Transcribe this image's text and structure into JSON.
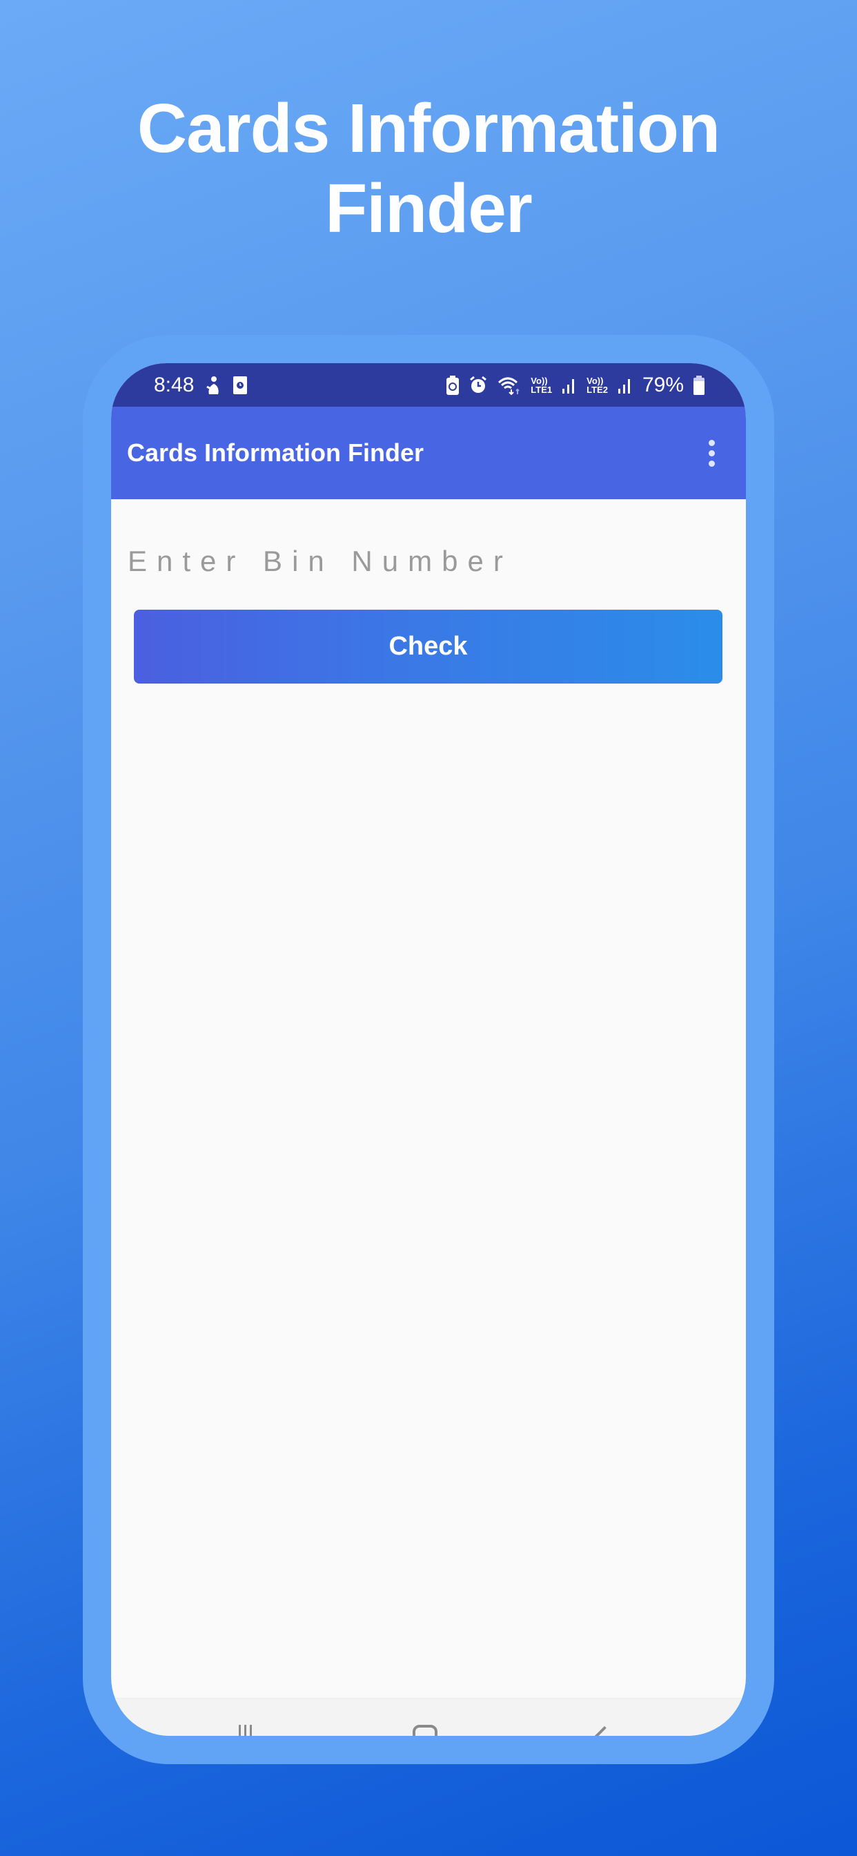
{
  "promo": {
    "title_line1": "Cards Information",
    "title_line2": "Finder"
  },
  "status_bar": {
    "time": "8:48",
    "left_icons": [
      "person-notification-icon",
      "clock-app-icon"
    ],
    "right_icons": [
      "battery-saver-icon",
      "alarm-icon",
      "wifi-icon",
      "volte-lte1-signal-icon",
      "volte-lte2-signal-icon"
    ],
    "lte1_top": "Vo))",
    "lte1_bottom": "LTE1",
    "lte2_top": "Vo))",
    "lte2_bottom": "LTE2",
    "battery": "79%"
  },
  "app_bar": {
    "title": "Cards Information Finder",
    "overflow_icon": "more-vert-icon"
  },
  "form": {
    "bin_input_value": "",
    "bin_input_placeholder": "Enter Bin Number",
    "check_label": "Check"
  },
  "nav_bar": {
    "items": [
      "recent-apps",
      "home",
      "back"
    ]
  },
  "colors": {
    "status_bar": "#2e3b9e",
    "app_bar": "#4866e3",
    "phone_frame": "#61a3f4",
    "button_start": "#4b5fe0",
    "button_end": "#2b8de9",
    "screen_bg": "#fafafa"
  }
}
